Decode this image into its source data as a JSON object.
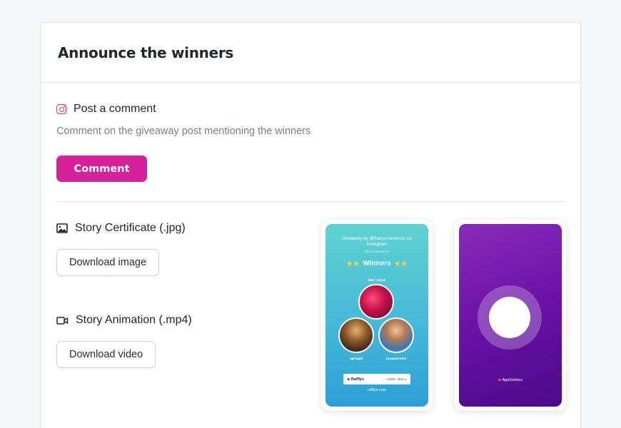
{
  "header": {
    "title": "Announce the winners"
  },
  "comment_section": {
    "icon": "instagram-icon",
    "title": "Post a comment",
    "description": "Comment on the giveaway post mentioning the winners",
    "button_label": "Comment"
  },
  "certificate_section": {
    "icon": "image-icon",
    "title": "Story Certificate (.jpg)",
    "button_label": "Download image"
  },
  "animation_section": {
    "icon": "video-icon",
    "title": "Story Animation (.mp4)",
    "button_label": "Download video"
  },
  "story_preview": {
    "giveaway_line": "Giveaway by @franconavarroo on Instagram",
    "subline": "@franconavarroo",
    "winners_label": "Winners",
    "winner_1": "fabri_vopez",
    "winner_2": "agesgall",
    "winner_3": "juanpaoredcl",
    "brand": "Rafflys",
    "code": "CODE: Mul.cL",
    "url": "rafflys.com"
  },
  "animation_preview": {
    "brand": "AppSorteos"
  },
  "colors": {
    "accent": "#d6229a",
    "story_bg_top": "#5fd3d0",
    "story_bg_bottom": "#2c9fd6",
    "animation_bg": "#6a11a6"
  }
}
